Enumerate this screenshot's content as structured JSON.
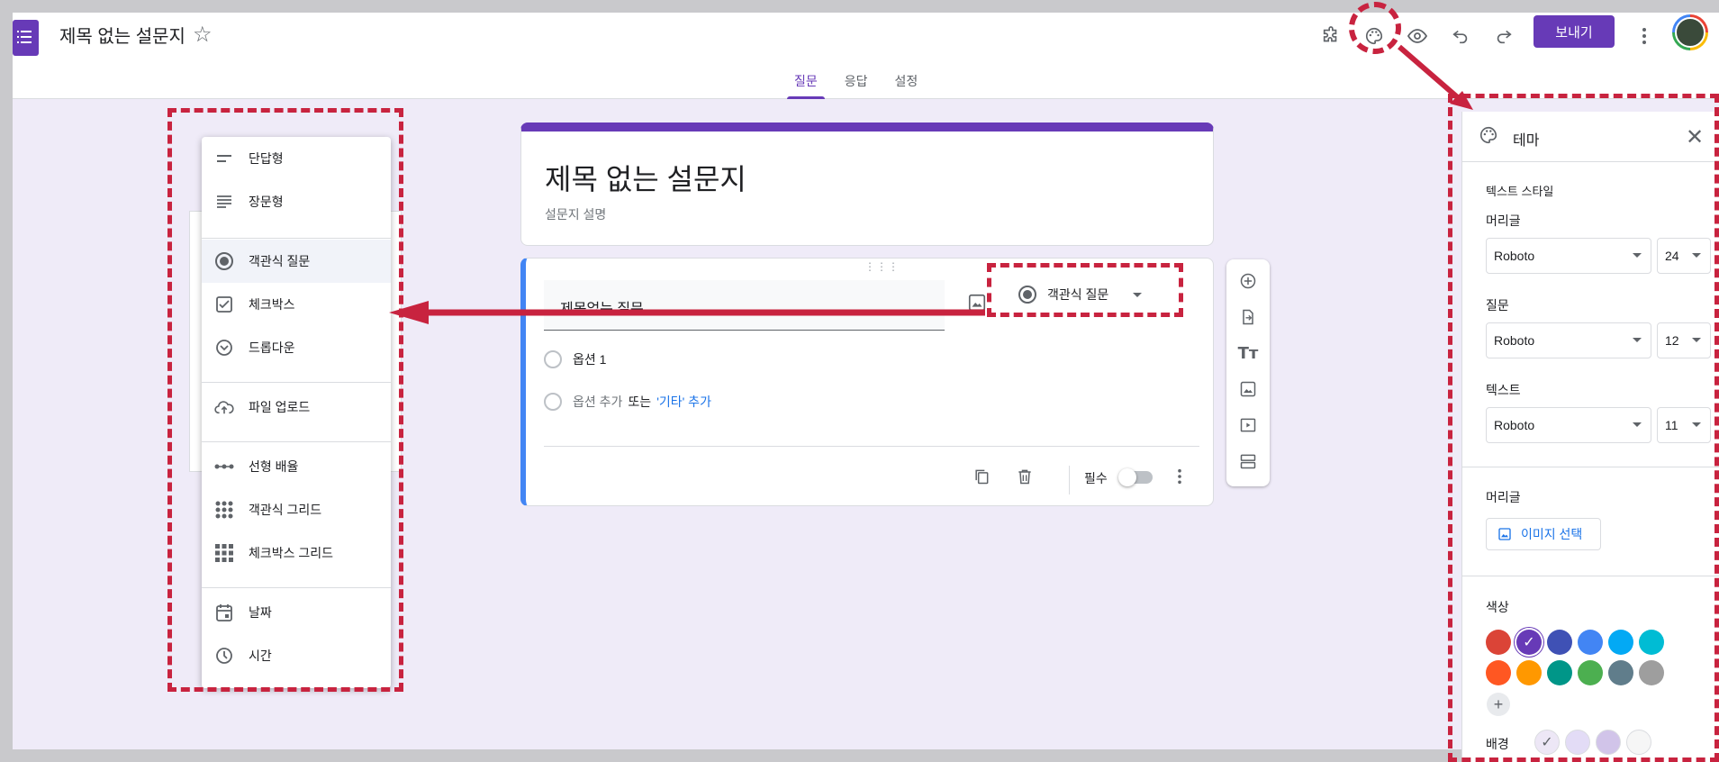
{
  "app": {
    "doc_title": "제목 없는 설문지",
    "send_label": "보내기"
  },
  "tabs": [
    {
      "label": "질문",
      "active": true
    },
    {
      "label": "응답",
      "active": false
    },
    {
      "label": "설정",
      "active": false
    }
  ],
  "form": {
    "title": "제목 없는 설문지",
    "description": "설문지 설명"
  },
  "question": {
    "title": "제목없는 질문",
    "type": "객관식 질문",
    "option1": "옵션 1",
    "add_option": "옵션 추가",
    "or": "또는",
    "add_other": "'기타' 추가",
    "required_label": "필수",
    "required": false
  },
  "menu": {
    "items": [
      {
        "label": "단답형",
        "icon": "short-answer-icon"
      },
      {
        "label": "장문형",
        "icon": "paragraph-icon"
      },
      {
        "label": "객관식 질문",
        "icon": "radio-icon",
        "selected": true
      },
      {
        "label": "체크박스",
        "icon": "checkbox-icon"
      },
      {
        "label": "드롭다운",
        "icon": "dropdown-icon"
      },
      {
        "label": "파일 업로드",
        "icon": "upload-icon"
      },
      {
        "label": "선형 배율",
        "icon": "linear-scale-icon"
      },
      {
        "label": "객관식 그리드",
        "icon": "radio-grid-icon"
      },
      {
        "label": "체크박스 그리드",
        "icon": "checkbox-grid-icon"
      },
      {
        "label": "날짜",
        "icon": "date-icon"
      },
      {
        "label": "시간",
        "icon": "time-icon"
      }
    ]
  },
  "theme": {
    "title": "테마",
    "text_style": "텍스트 스타일",
    "header_label": "머리글",
    "header_font": "Roboto",
    "header_size": "24",
    "question_label": "질문",
    "question_font": "Roboto",
    "question_size": "12",
    "text_label": "텍스트",
    "text_font": "Roboto",
    "text_size": "11",
    "header_image_label": "머리글",
    "image_select": "이미지 선택",
    "color_label": "색상",
    "background_label": "배경",
    "colors": [
      "#db4437",
      "#673ab7",
      "#3f51b5",
      "#4285f4",
      "#03a9f4",
      "#00bcd4",
      "#ff5722",
      "#ff9800",
      "#009688",
      "#4caf50",
      "#607d8b",
      "#9e9e9e"
    ],
    "selected_color": "#673ab7",
    "backgrounds": [
      "#ede7f6",
      "#e3dcf6",
      "#d1c4e9",
      "#f6f6f6"
    ]
  },
  "accent": {
    "primary": "#673ab7",
    "annotation": "#c8233f"
  }
}
